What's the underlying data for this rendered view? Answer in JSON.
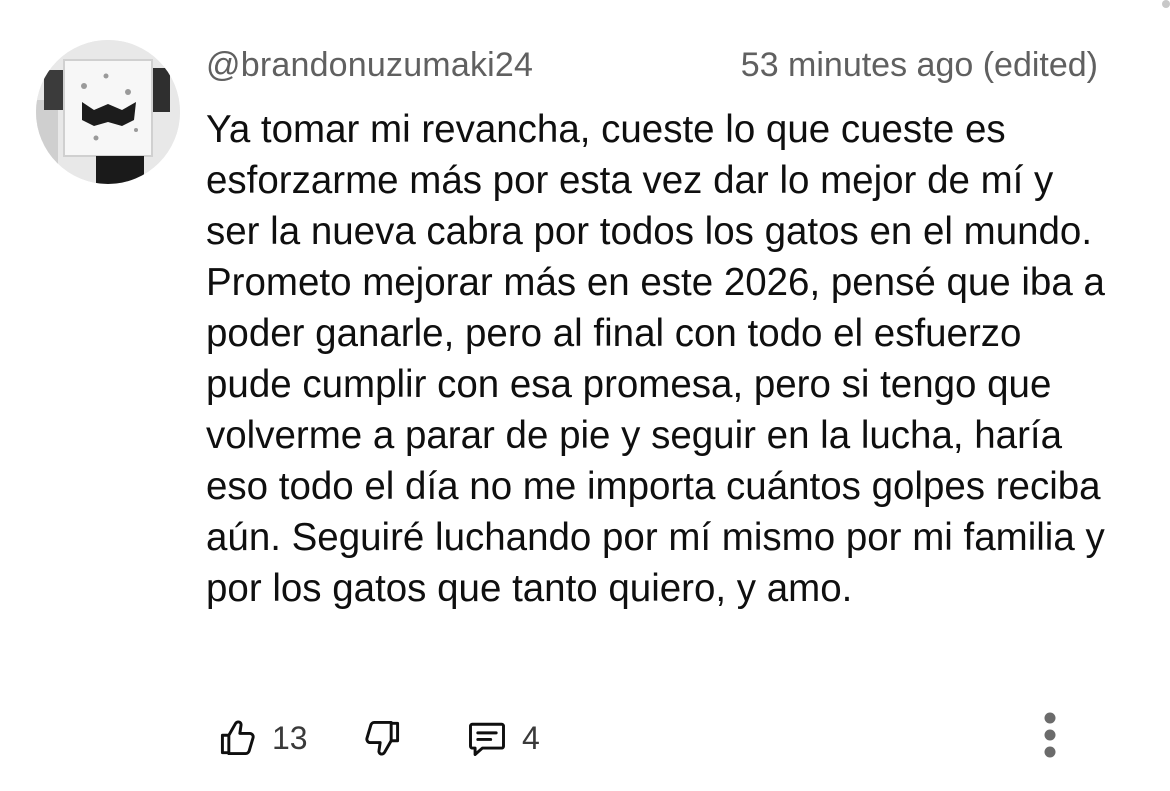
{
  "comment": {
    "author": "@brandonuzumaki24",
    "timestamp": "53 minutes ago (edited)",
    "text": "Ya tomar mi revancha, cueste lo que cueste es esforzarme más por esta vez dar lo mejor de mí y ser la nueva cabra por todos los gatos en el mundo. Prometo mejorar más en este 2026, pensé que iba a poder ganarle, pero al final con todo el esfuerzo pude cumplir con esa promesa, pero si tengo que volverme a parar de pie y seguir en la lucha, haría eso todo el día no me importa cuántos golpes reciba aún. Seguiré luchando por mí mismo por mi familia y por los gatos que tanto quiero, y amo.",
    "likes": "13",
    "replies": "4"
  },
  "icons": {
    "like": "thumbs-up-icon",
    "dislike": "thumbs-down-icon",
    "reply": "comment-icon",
    "more": "more-vertical-icon"
  },
  "colors": {
    "text": "#0f0f0f",
    "secondary_text": "#606060",
    "icon": "#0f0f0f"
  }
}
